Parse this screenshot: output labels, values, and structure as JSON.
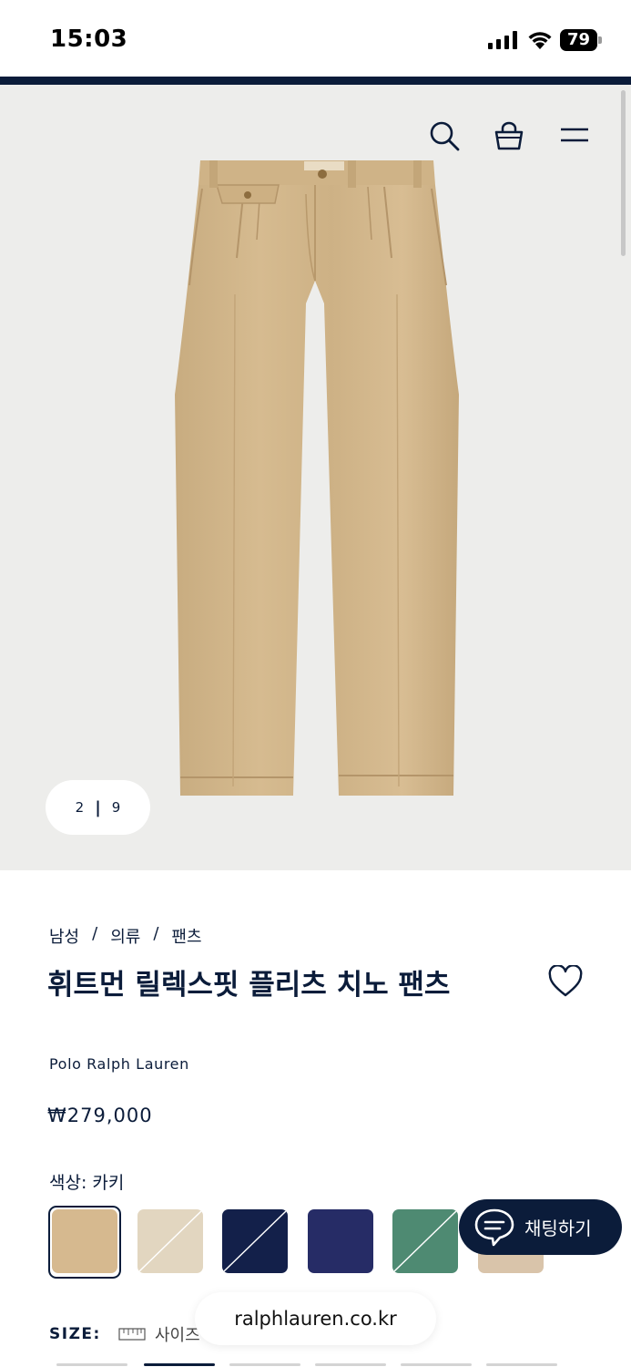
{
  "status_bar": {
    "time": "15:03",
    "battery": "79"
  },
  "gallery": {
    "current": "2",
    "separator": "|",
    "total": "9"
  },
  "breadcrumb": {
    "items": [
      "남성",
      "의류",
      "팬츠"
    ],
    "separator": "/"
  },
  "product": {
    "title": "휘트먼 릴렉스핏 플리츠 치노 팬츠",
    "brand": "Polo Ralph Lauren",
    "price": "₩279,000",
    "color_label": "색상: 카키"
  },
  "swatches": [
    {
      "name": "khaki",
      "color": "#d6b98f",
      "selected": true
    },
    {
      "name": "stone",
      "color": "#e2d6c0",
      "selected": false
    },
    {
      "name": "navy",
      "color": "#13204a",
      "selected": false
    },
    {
      "name": "blue-navy",
      "color": "#262c66",
      "selected": false
    },
    {
      "name": "green",
      "color": "#4e8a72",
      "selected": false
    },
    {
      "name": "tan",
      "color": "#d9c4aa",
      "selected": false
    }
  ],
  "chat": {
    "label": "채팅하기"
  },
  "size": {
    "label": "SIZE:",
    "guide_label": "사이즈"
  },
  "browser": {
    "url": "ralphlauren.co.kr"
  },
  "icons": {
    "search": "search-icon",
    "bag": "shopping-bag-icon",
    "menu": "hamburger-menu-icon",
    "wishlist": "heart-icon",
    "chat": "chat-bubble-icon",
    "ruler": "ruler-icon"
  },
  "colors": {
    "navy": "#0b1c3a",
    "hero_bg": "#ededeb"
  }
}
